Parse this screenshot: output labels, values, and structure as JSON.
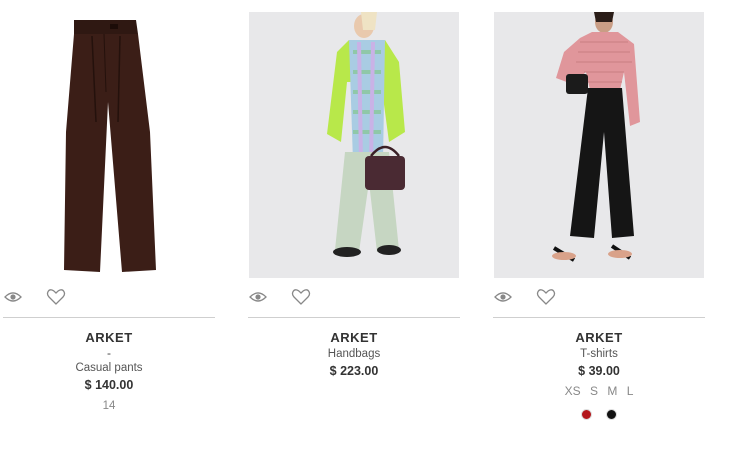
{
  "products": [
    {
      "brand": "ARKET",
      "dash": "-",
      "category": "Casual pants",
      "price": "$ 140.00",
      "count": "14",
      "image_icon": "brown-wide-leg-trousers-photo"
    },
    {
      "brand": "ARKET",
      "category": "Handbags",
      "price": "$ 223.00",
      "image_icon": "model-with-green-sweater-scarf-handbag-photo"
    },
    {
      "brand": "ARKET",
      "category": "T-shirts",
      "price": "$ 39.00",
      "sizes": [
        "XS",
        "S",
        "M",
        "L"
      ],
      "colors": [
        "#b3161b",
        "#111111"
      ],
      "image_icon": "model-pink-top-black-pants-photo"
    }
  ],
  "icons": {
    "quick_view": "eye-icon",
    "wishlist": "heart-icon"
  },
  "colors": {
    "trouser_brown": "#3b1e17",
    "divider": "#cfcfcf"
  }
}
